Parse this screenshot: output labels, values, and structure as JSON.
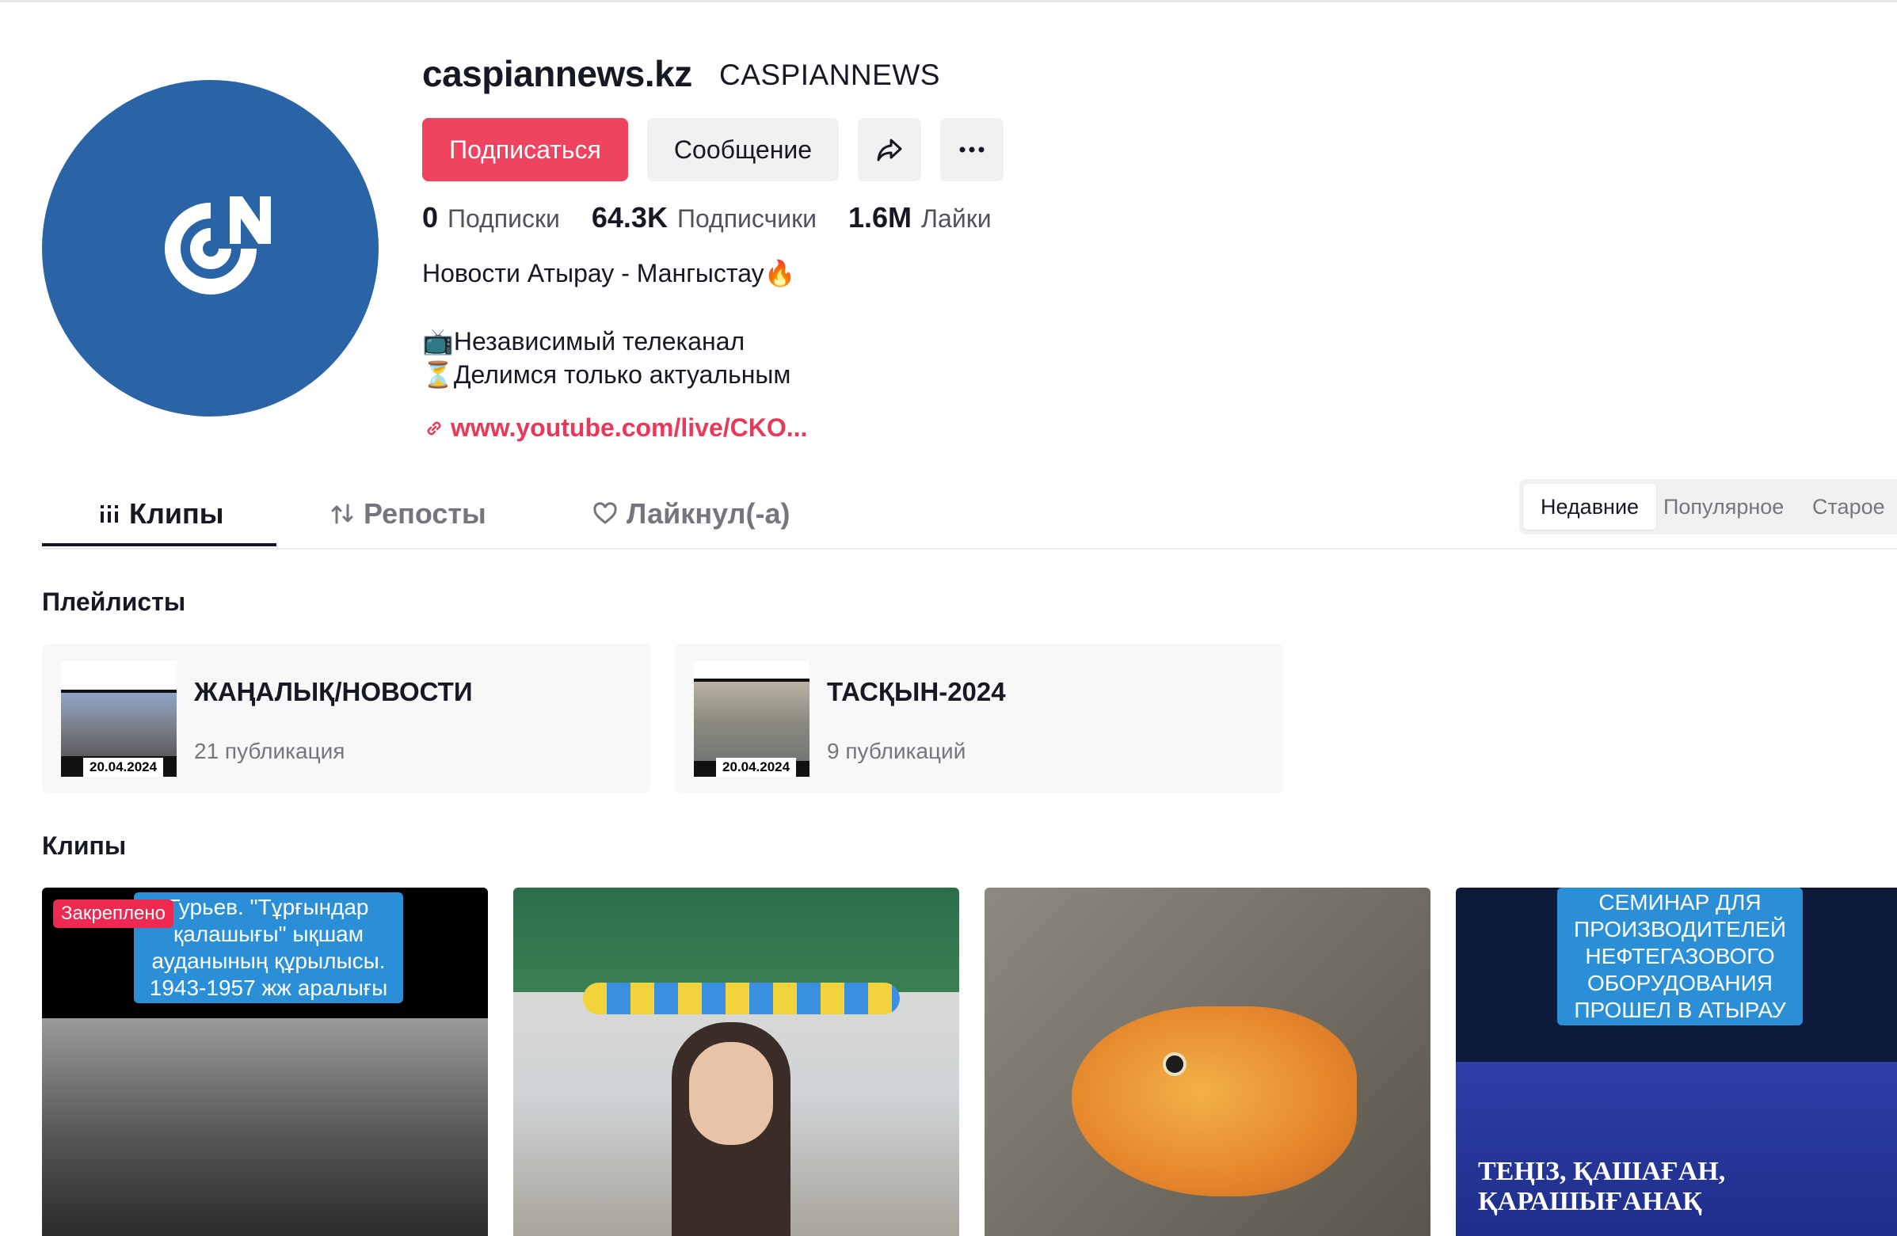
{
  "profile": {
    "username": "caspiannews.kz",
    "nickname": "CASPIANNEWS",
    "follow_label": "Подписаться",
    "message_label": "Сообщение",
    "stats": {
      "following_count": "0",
      "following_label": "Подписки",
      "followers_count": "64.3K",
      "followers_label": "Подписчики",
      "likes_count": "1.6M",
      "likes_label": "Лайки"
    },
    "bio_line1": "Новости Атырау - Мангыстау🔥",
    "bio_line2": "📺Независимый телеканал",
    "bio_line3": "⏳Делимся только актуальным",
    "link": "www.youtube.com/live/CKO..."
  },
  "tabs": [
    {
      "label": "Клипы"
    },
    {
      "label": "Репосты"
    },
    {
      "label": "Лайкнул(-а)"
    }
  ],
  "sort": {
    "recent": "Недавние",
    "popular": "Популярное",
    "oldest": "Старое"
  },
  "playlists": {
    "heading": "Плейлисты",
    "items": [
      {
        "title": "ЖАҢАЛЫҚ/НОВОСТИ",
        "count": "21 публикация",
        "date": "20.04.2024"
      },
      {
        "title": "ТАСҚЫН-2024",
        "count": "9 публикаций",
        "date": "20.04.2024"
      }
    ]
  },
  "clips": {
    "heading": "Клипы",
    "pinned_label": "Закреплено",
    "clip1_caption": "Гурьев. \"Тұрғындар қалашығы\" ықшам ауданының құрылысы. 1943-1957 жж аралығы",
    "clip4_caption": "СЕМИНАР ДЛЯ ПРОИЗВОДИТЕЛЕЙ НЕФТЕГАЗОВОГО ОБОРУДОВАНИЯ ПРОШЕЛ В АТЫРАУ",
    "clip4_banner": "ТЕҢІЗ, ҚАШАҒАН, ҚАРАШЫҒАНАҚ"
  },
  "colors": {
    "accent": "#ef4460",
    "link": "#e8395b",
    "avatar_bg": "#2a64a7"
  }
}
